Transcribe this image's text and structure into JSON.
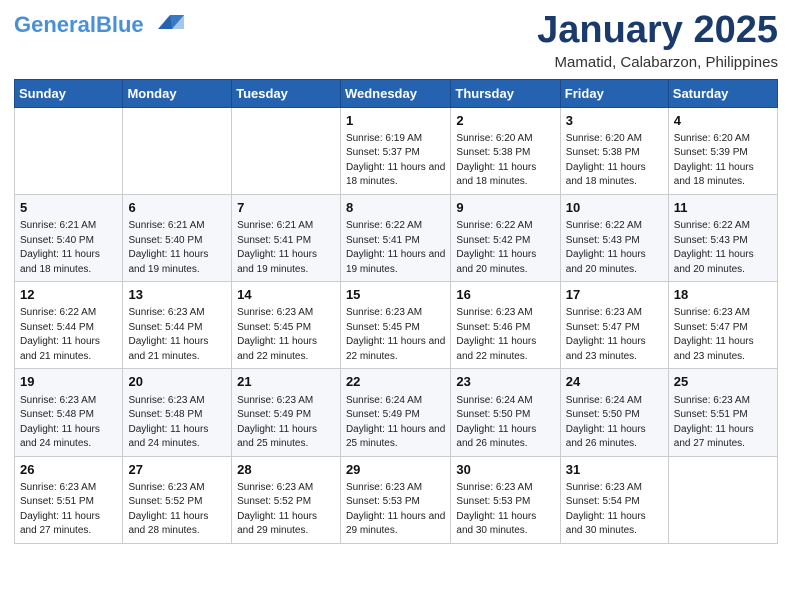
{
  "header": {
    "logo_general": "General",
    "logo_blue": "Blue",
    "month": "January 2025",
    "location": "Mamatid, Calabarzon, Philippines"
  },
  "weekdays": [
    "Sunday",
    "Monday",
    "Tuesday",
    "Wednesday",
    "Thursday",
    "Friday",
    "Saturday"
  ],
  "weeks": [
    [
      {
        "day": "",
        "sunrise": "",
        "sunset": "",
        "daylight": ""
      },
      {
        "day": "",
        "sunrise": "",
        "sunset": "",
        "daylight": ""
      },
      {
        "day": "",
        "sunrise": "",
        "sunset": "",
        "daylight": ""
      },
      {
        "day": "1",
        "sunrise": "Sunrise: 6:19 AM",
        "sunset": "Sunset: 5:37 PM",
        "daylight": "Daylight: 11 hours and 18 minutes."
      },
      {
        "day": "2",
        "sunrise": "Sunrise: 6:20 AM",
        "sunset": "Sunset: 5:38 PM",
        "daylight": "Daylight: 11 hours and 18 minutes."
      },
      {
        "day": "3",
        "sunrise": "Sunrise: 6:20 AM",
        "sunset": "Sunset: 5:38 PM",
        "daylight": "Daylight: 11 hours and 18 minutes."
      },
      {
        "day": "4",
        "sunrise": "Sunrise: 6:20 AM",
        "sunset": "Sunset: 5:39 PM",
        "daylight": "Daylight: 11 hours and 18 minutes."
      }
    ],
    [
      {
        "day": "5",
        "sunrise": "Sunrise: 6:21 AM",
        "sunset": "Sunset: 5:40 PM",
        "daylight": "Daylight: 11 hours and 18 minutes."
      },
      {
        "day": "6",
        "sunrise": "Sunrise: 6:21 AM",
        "sunset": "Sunset: 5:40 PM",
        "daylight": "Daylight: 11 hours and 19 minutes."
      },
      {
        "day": "7",
        "sunrise": "Sunrise: 6:21 AM",
        "sunset": "Sunset: 5:41 PM",
        "daylight": "Daylight: 11 hours and 19 minutes."
      },
      {
        "day": "8",
        "sunrise": "Sunrise: 6:22 AM",
        "sunset": "Sunset: 5:41 PM",
        "daylight": "Daylight: 11 hours and 19 minutes."
      },
      {
        "day": "9",
        "sunrise": "Sunrise: 6:22 AM",
        "sunset": "Sunset: 5:42 PM",
        "daylight": "Daylight: 11 hours and 20 minutes."
      },
      {
        "day": "10",
        "sunrise": "Sunrise: 6:22 AM",
        "sunset": "Sunset: 5:43 PM",
        "daylight": "Daylight: 11 hours and 20 minutes."
      },
      {
        "day": "11",
        "sunrise": "Sunrise: 6:22 AM",
        "sunset": "Sunset: 5:43 PM",
        "daylight": "Daylight: 11 hours and 20 minutes."
      }
    ],
    [
      {
        "day": "12",
        "sunrise": "Sunrise: 6:22 AM",
        "sunset": "Sunset: 5:44 PM",
        "daylight": "Daylight: 11 hours and 21 minutes."
      },
      {
        "day": "13",
        "sunrise": "Sunrise: 6:23 AM",
        "sunset": "Sunset: 5:44 PM",
        "daylight": "Daylight: 11 hours and 21 minutes."
      },
      {
        "day": "14",
        "sunrise": "Sunrise: 6:23 AM",
        "sunset": "Sunset: 5:45 PM",
        "daylight": "Daylight: 11 hours and 22 minutes."
      },
      {
        "day": "15",
        "sunrise": "Sunrise: 6:23 AM",
        "sunset": "Sunset: 5:45 PM",
        "daylight": "Daylight: 11 hours and 22 minutes."
      },
      {
        "day": "16",
        "sunrise": "Sunrise: 6:23 AM",
        "sunset": "Sunset: 5:46 PM",
        "daylight": "Daylight: 11 hours and 22 minutes."
      },
      {
        "day": "17",
        "sunrise": "Sunrise: 6:23 AM",
        "sunset": "Sunset: 5:47 PM",
        "daylight": "Daylight: 11 hours and 23 minutes."
      },
      {
        "day": "18",
        "sunrise": "Sunrise: 6:23 AM",
        "sunset": "Sunset: 5:47 PM",
        "daylight": "Daylight: 11 hours and 23 minutes."
      }
    ],
    [
      {
        "day": "19",
        "sunrise": "Sunrise: 6:23 AM",
        "sunset": "Sunset: 5:48 PM",
        "daylight": "Daylight: 11 hours and 24 minutes."
      },
      {
        "day": "20",
        "sunrise": "Sunrise: 6:23 AM",
        "sunset": "Sunset: 5:48 PM",
        "daylight": "Daylight: 11 hours and 24 minutes."
      },
      {
        "day": "21",
        "sunrise": "Sunrise: 6:23 AM",
        "sunset": "Sunset: 5:49 PM",
        "daylight": "Daylight: 11 hours and 25 minutes."
      },
      {
        "day": "22",
        "sunrise": "Sunrise: 6:24 AM",
        "sunset": "Sunset: 5:49 PM",
        "daylight": "Daylight: 11 hours and 25 minutes."
      },
      {
        "day": "23",
        "sunrise": "Sunrise: 6:24 AM",
        "sunset": "Sunset: 5:50 PM",
        "daylight": "Daylight: 11 hours and 26 minutes."
      },
      {
        "day": "24",
        "sunrise": "Sunrise: 6:24 AM",
        "sunset": "Sunset: 5:50 PM",
        "daylight": "Daylight: 11 hours and 26 minutes."
      },
      {
        "day": "25",
        "sunrise": "Sunrise: 6:23 AM",
        "sunset": "Sunset: 5:51 PM",
        "daylight": "Daylight: 11 hours and 27 minutes."
      }
    ],
    [
      {
        "day": "26",
        "sunrise": "Sunrise: 6:23 AM",
        "sunset": "Sunset: 5:51 PM",
        "daylight": "Daylight: 11 hours and 27 minutes."
      },
      {
        "day": "27",
        "sunrise": "Sunrise: 6:23 AM",
        "sunset": "Sunset: 5:52 PM",
        "daylight": "Daylight: 11 hours and 28 minutes."
      },
      {
        "day": "28",
        "sunrise": "Sunrise: 6:23 AM",
        "sunset": "Sunset: 5:52 PM",
        "daylight": "Daylight: 11 hours and 29 minutes."
      },
      {
        "day": "29",
        "sunrise": "Sunrise: 6:23 AM",
        "sunset": "Sunset: 5:53 PM",
        "daylight": "Daylight: 11 hours and 29 minutes."
      },
      {
        "day": "30",
        "sunrise": "Sunrise: 6:23 AM",
        "sunset": "Sunset: 5:53 PM",
        "daylight": "Daylight: 11 hours and 30 minutes."
      },
      {
        "day": "31",
        "sunrise": "Sunrise: 6:23 AM",
        "sunset": "Sunset: 5:54 PM",
        "daylight": "Daylight: 11 hours and 30 minutes."
      },
      {
        "day": "",
        "sunrise": "",
        "sunset": "",
        "daylight": ""
      }
    ]
  ]
}
